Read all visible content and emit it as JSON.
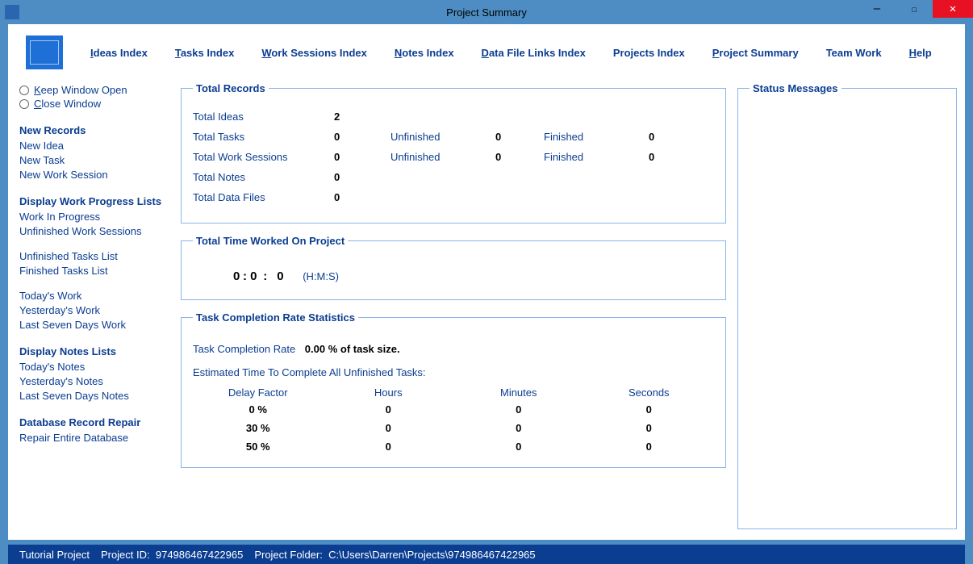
{
  "window": {
    "title": "Project Summary"
  },
  "menubar": {
    "ideas": "deas Index",
    "tasks": "asks Index",
    "work": "ork Sessions Index",
    "notes": "otes Index",
    "data": "ata File Links Index",
    "projects": "Projects Index",
    "summary_pre": "roject Summary",
    "team": "Team Work",
    "help_pre": "elp"
  },
  "sidebar": {
    "keep": "eep Window Open",
    "close": "lose Window",
    "new_records": "New Records",
    "new_idea": "New Idea",
    "new_task": "New Task",
    "new_ws": "New Work Session",
    "disp_wp": "Display Work Progress Lists",
    "wip": "Work In Progress",
    "uws": "Unfinished Work Sessions",
    "utl": "Unfinished Tasks List",
    "ftl": "Finished Tasks List",
    "today_work": "Today's Work",
    "yest_work": "Yesterday's Work",
    "last7_work": "Last Seven Days Work",
    "disp_notes": "Display Notes Lists",
    "today_notes": "Today's Notes",
    "yest_notes": "Yesterday's Notes",
    "last7_notes": "Last Seven Days Notes",
    "db_repair": "Database Record Repair",
    "repair": "Repair Entire Database"
  },
  "records": {
    "title": "Total Records",
    "ideas_label": "Total Ideas",
    "ideas_val": "2",
    "tasks_label": "Total Tasks",
    "tasks_val": "0",
    "tasks_unf_label": "Unfinished",
    "tasks_unf_val": "0",
    "tasks_fin_label": "Finished",
    "tasks_fin_val": "0",
    "ws_label": "Total Work Sessions",
    "ws_val": "0",
    "ws_unf_label": "Unfinished",
    "ws_unf_val": "0",
    "ws_fin_label": "Finished",
    "ws_fin_val": "0",
    "notes_label": "Total Notes",
    "notes_val": "0",
    "files_label": "Total Data Files",
    "files_val": "0"
  },
  "time": {
    "title": "Total Time Worked On Project",
    "h": "0",
    "m": "0",
    "s": "0",
    "hms": "(H:M:S)"
  },
  "completion": {
    "title": "Task Completion Rate Statistics",
    "rate_label": "Task Completion Rate",
    "rate_val": "0.00 % of task size.",
    "est_label": "Estimated Time To Complete All Unfinished Tasks:",
    "col_delay": "Delay Factor",
    "col_hours": "Hours",
    "col_mins": "Minutes",
    "col_secs": "Seconds",
    "rows": [
      {
        "d": "0 %",
        "h": "0",
        "m": "0",
        "s": "0"
      },
      {
        "d": "30 %",
        "h": "0",
        "m": "0",
        "s": "0"
      },
      {
        "d": "50 %",
        "h": "0",
        "m": "0",
        "s": "0"
      }
    ]
  },
  "status_title": "Status Messages",
  "footer": {
    "project_name": "Tutorial Project",
    "project_id_label": "Project ID:",
    "project_id": "974986467422965",
    "folder_label": "Project Folder:",
    "folder": "C:\\Users\\Darren\\Projects\\974986467422965"
  }
}
